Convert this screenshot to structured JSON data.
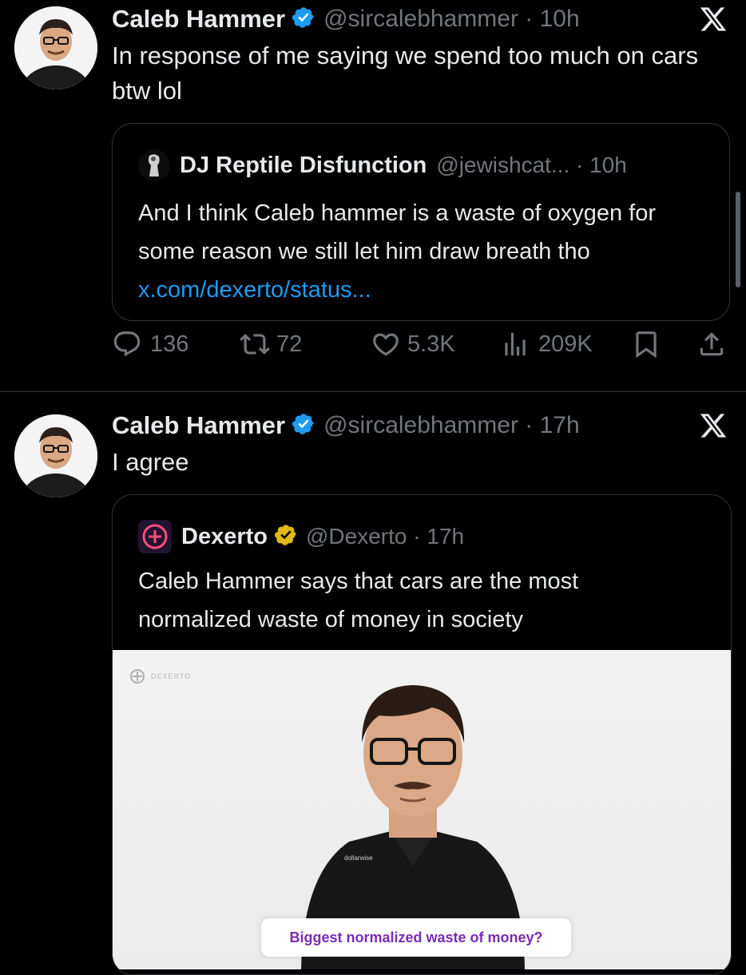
{
  "tweets": [
    {
      "author_name": "Caleb Hammer",
      "handle_time": "@sircalebhammer · 10h",
      "text": "In response of me saying we spend too much on cars btw lol",
      "quote": {
        "author_name": "DJ Reptile Disfunction",
        "handle_time": "@jewishcat... · 10h",
        "text": "And I think Caleb hammer is a waste of oxygen for some reason we still let him draw breath tho ",
        "link": "x.com/dexerto/status..."
      },
      "actions": {
        "replies": "136",
        "reposts": "72",
        "likes": "5.3K",
        "views": "209K"
      }
    },
    {
      "author_name": "Caleb Hammer",
      "handle_time": "@sircalebhammer · 17h",
      "text": "I agree",
      "quote": {
        "author_name": "Dexerto",
        "handle_time": "@Dexerto · 17h",
        "text": "Caleb Hammer says that cars are the most normalized waste of money in society",
        "media": {
          "watermark": "DEXERTO",
          "shirt_logo": "dollarwise",
          "caption": "Biggest normalized waste of money?"
        }
      }
    }
  ],
  "colors": {
    "background": "#000000",
    "text": "#e7e9ea",
    "secondary": "#71767b",
    "link": "#1d9bf0",
    "verified_blue": "#1d9bf0",
    "verified_gold": "#e2b719"
  }
}
